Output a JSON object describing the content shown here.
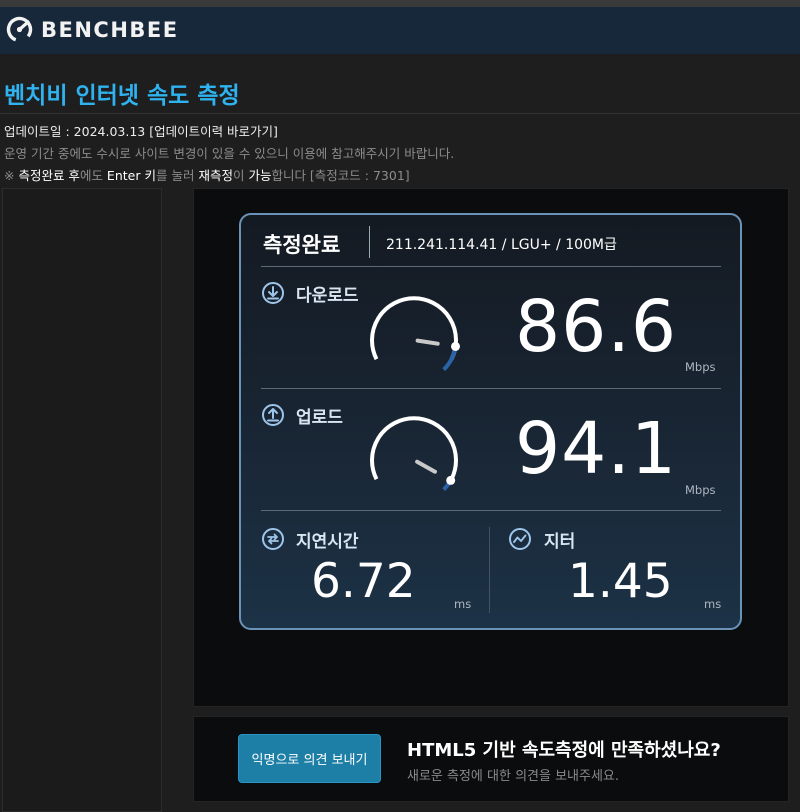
{
  "brand": {
    "name": "BENCHBEE"
  },
  "page": {
    "title": "벤치비 인터넷 속도 측정"
  },
  "info": {
    "update_line": "업데이트일 : 2024.03.13 [업데이트이력 바로가기]",
    "notice_line": "운영 기간 중에도 수시로 사이트 변경이 있을 수 있으니 이용에 참고해주시기 바랍니다.",
    "tip": {
      "mark": "※ ",
      "p1": "측정완료 후",
      "p2": "에도 ",
      "p3": "Enter",
      "p4": " ",
      "p5": "키",
      "p6": "를 눌러 ",
      "p7": "재측정",
      "p8": "이 ",
      "p9": "가능",
      "p10": "합니다 [측정코드 : 7301]"
    }
  },
  "result": {
    "status": "측정완료",
    "meta": "211.241.114.41 / LGU+ / 100M급",
    "download": {
      "label": "다운로드",
      "value": "86.6",
      "unit": "Mbps",
      "gauge_fraction": 0.866
    },
    "upload": {
      "label": "업로드",
      "value": "94.1",
      "unit": "Mbps",
      "gauge_fraction": 0.941
    },
    "latency": {
      "label": "지연시간",
      "value": "6.72",
      "unit": "ms"
    },
    "jitter": {
      "label": "지터",
      "value": "1.45",
      "unit": "ms"
    }
  },
  "feedback": {
    "button": "익명으로 의견 보내기",
    "question": "HTML5 기반 속도측정에 만족하셨나요?",
    "sub": "새로운 측정에 대한 의견을 보내주세요."
  },
  "colors": {
    "accent": "#2fb3f0",
    "header_bg": "#17283a",
    "card_border": "#6b93b8",
    "gauge_active": "#2a63a8",
    "button": "#1d7ea6"
  }
}
